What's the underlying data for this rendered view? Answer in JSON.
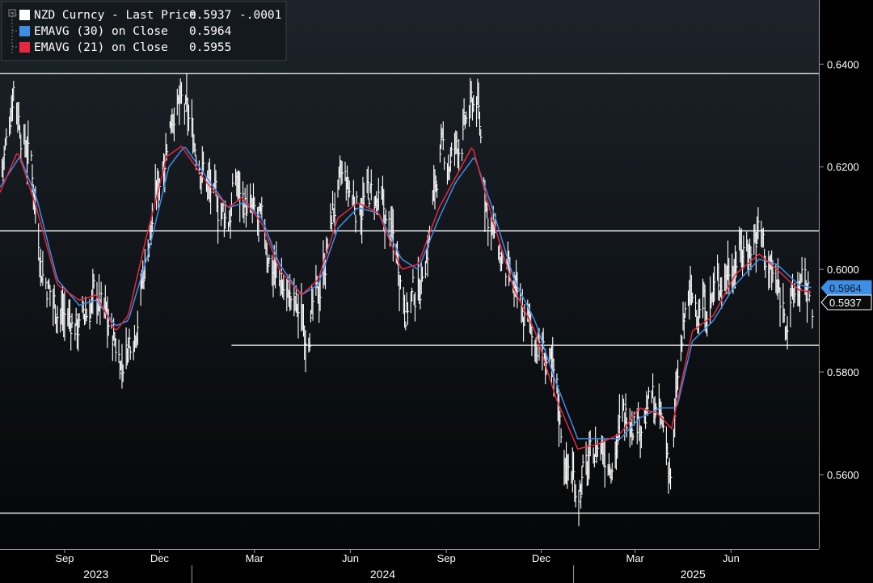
{
  "chart_data": {
    "type": "line",
    "subtype": "high-low bars with moving averages",
    "ylim": [
      0.5455,
      0.6525
    ],
    "y_ticks": [
      "0.6400",
      "0.6200",
      "0.6000",
      "0.5800",
      "0.5600"
    ],
    "y_tick_values": [
      0.64,
      0.62,
      0.6,
      0.58,
      0.56
    ],
    "x_start": "2023-07-01",
    "x_end": "2025-08-18",
    "x_ticks": [
      {
        "label": "Sep",
        "date": "2023-09-01"
      },
      {
        "label": "Dec",
        "date": "2023-12-01"
      },
      {
        "label": "Mar",
        "date": "2024-03-01"
      },
      {
        "label": "Jun",
        "date": "2024-06-01"
      },
      {
        "label": "Sep",
        "date": "2024-09-01"
      },
      {
        "label": "Dec",
        "date": "2024-12-01"
      },
      {
        "label": "Mar",
        "date": "2025-03-01"
      },
      {
        "label": "Jun",
        "date": "2025-06-01"
      }
    ],
    "years": [
      {
        "label": "2023",
        "from": "2023-07-01",
        "to": "2024-01-01"
      },
      {
        "label": "2024",
        "from": "2024-01-01",
        "to": "2025-01-01"
      },
      {
        "label": "2025",
        "from": "2025-01-01",
        "to": "2025-08-18"
      }
    ],
    "h_lines": [
      {
        "y": 0.6382,
        "from": "2023-07-01"
      },
      {
        "y": 0.6075,
        "from": "2023-07-01"
      },
      {
        "y": 0.5852,
        "from": "2024-02-08"
      },
      {
        "y": 0.5525,
        "from": "2023-07-01"
      }
    ],
    "legend": [
      {
        "color_key": "price",
        "name": "NZD Curncy - Last Price",
        "value": "0.5937",
        "change": "-.0001"
      },
      {
        "color_key": "ema30",
        "name": "EMAVG (30)  on Close",
        "value": "0.5964",
        "change": ""
      },
      {
        "color_key": "ema21",
        "name": "EMAVG (21)  on Close",
        "value": "0.5955",
        "change": ""
      }
    ],
    "last_value_tags": [
      {
        "label": "0.5964",
        "value": 0.5964,
        "color_key": "ema30"
      },
      {
        "label": "0.5937",
        "value": 0.5937,
        "color_key": "price"
      }
    ],
    "price_anchors": [
      [
        "2023-07-01",
        0.618
      ],
      [
        "2023-07-08",
        0.625
      ],
      [
        "2023-07-14",
        0.637
      ],
      [
        "2023-07-21",
        0.628
      ],
      [
        "2023-07-31",
        0.621
      ],
      [
        "2023-08-10",
        0.601
      ],
      [
        "2023-08-20",
        0.594
      ],
      [
        "2023-09-01",
        0.591
      ],
      [
        "2023-09-15",
        0.589
      ],
      [
        "2023-10-01",
        0.595
      ],
      [
        "2023-10-15",
        0.588
      ],
      [
        "2023-10-26",
        0.582
      ],
      [
        "2023-11-08",
        0.59
      ],
      [
        "2023-11-20",
        0.605
      ],
      [
        "2023-11-28",
        0.614
      ],
      [
        "2023-12-08",
        0.626
      ],
      [
        "2023-12-15",
        0.633
      ],
      [
        "2023-12-28",
        0.629
      ],
      [
        "2024-01-10",
        0.621
      ],
      [
        "2024-01-22",
        0.613
      ],
      [
        "2024-02-05",
        0.61
      ],
      [
        "2024-02-12",
        0.617
      ],
      [
        "2024-02-25",
        0.611
      ],
      [
        "2024-03-08",
        0.607
      ],
      [
        "2024-03-20",
        0.6
      ],
      [
        "2024-04-05",
        0.594
      ],
      [
        "2024-04-18",
        0.589
      ],
      [
        "2024-05-01",
        0.594
      ],
      [
        "2024-05-15",
        0.611
      ],
      [
        "2024-05-25",
        0.617
      ],
      [
        "2024-06-05",
        0.613
      ],
      [
        "2024-06-20",
        0.614
      ],
      [
        "2024-07-01",
        0.611
      ],
      [
        "2024-07-15",
        0.604
      ],
      [
        "2024-07-25",
        0.593
      ],
      [
        "2024-08-05",
        0.596
      ],
      [
        "2024-08-15",
        0.606
      ],
      [
        "2024-08-25",
        0.622
      ],
      [
        "2024-09-05",
        0.621
      ],
      [
        "2024-09-18",
        0.627
      ],
      [
        "2024-09-30",
        0.634
      ],
      [
        "2024-10-10",
        0.612
      ],
      [
        "2024-10-25",
        0.6
      ],
      [
        "2024-11-10",
        0.592
      ],
      [
        "2024-11-25",
        0.587
      ],
      [
        "2024-12-05",
        0.583
      ],
      [
        "2024-12-15",
        0.576
      ],
      [
        "2024-12-25",
        0.562
      ],
      [
        "2025-01-05",
        0.558
      ],
      [
        "2025-01-15",
        0.561
      ],
      [
        "2025-01-25",
        0.566
      ],
      [
        "2025-02-05",
        0.564
      ],
      [
        "2025-02-15",
        0.569
      ],
      [
        "2025-02-25",
        0.573
      ],
      [
        "2025-03-08",
        0.571
      ],
      [
        "2025-03-18",
        0.574
      ],
      [
        "2025-03-28",
        0.568
      ],
      [
        "2025-04-05",
        0.56
      ],
      [
        "2025-04-10",
        0.576
      ],
      [
        "2025-04-20",
        0.594
      ],
      [
        "2025-05-01",
        0.593
      ],
      [
        "2025-05-12",
        0.594
      ],
      [
        "2025-05-22",
        0.598
      ],
      [
        "2025-06-05",
        0.603
      ],
      [
        "2025-06-20",
        0.605
      ],
      [
        "2025-06-28",
        0.608
      ],
      [
        "2025-07-05",
        0.602
      ],
      [
        "2025-07-15",
        0.596
      ],
      [
        "2025-07-25",
        0.591
      ],
      [
        "2025-08-05",
        0.597
      ],
      [
        "2025-08-18",
        0.5937
      ]
    ],
    "ema30_anchors": [
      [
        "2023-07-01",
        0.616
      ],
      [
        "2023-07-20",
        0.622
      ],
      [
        "2023-08-05",
        0.614
      ],
      [
        "2023-08-25",
        0.598
      ],
      [
        "2023-09-15",
        0.593
      ],
      [
        "2023-10-01",
        0.594
      ],
      [
        "2023-10-20",
        0.589
      ],
      [
        "2023-11-01",
        0.59
      ],
      [
        "2023-11-20",
        0.603
      ],
      [
        "2023-12-10",
        0.62
      ],
      [
        "2023-12-25",
        0.624
      ],
      [
        "2024-01-15",
        0.618
      ],
      [
        "2024-02-05",
        0.612
      ],
      [
        "2024-02-20",
        0.613
      ],
      [
        "2024-03-08",
        0.61
      ],
      [
        "2024-03-25",
        0.601
      ],
      [
        "2024-04-15",
        0.595
      ],
      [
        "2024-05-01",
        0.597
      ],
      [
        "2024-05-20",
        0.608
      ],
      [
        "2024-06-08",
        0.612
      ],
      [
        "2024-06-28",
        0.611
      ],
      [
        "2024-07-20",
        0.602
      ],
      [
        "2024-08-05",
        0.6
      ],
      [
        "2024-08-25",
        0.61
      ],
      [
        "2024-09-10",
        0.617
      ],
      [
        "2024-09-28",
        0.622
      ],
      [
        "2024-10-15",
        0.612
      ],
      [
        "2024-11-05",
        0.598
      ],
      [
        "2024-11-25",
        0.59
      ],
      [
        "2024-12-15",
        0.578
      ],
      [
        "2025-01-05",
        0.567
      ],
      [
        "2025-01-25",
        0.567
      ],
      [
        "2025-02-15",
        0.567
      ],
      [
        "2025-03-05",
        0.571
      ],
      [
        "2025-03-25",
        0.573
      ],
      [
        "2025-04-10",
        0.573
      ],
      [
        "2025-04-25",
        0.586
      ],
      [
        "2025-05-15",
        0.59
      ],
      [
        "2025-06-05",
        0.597
      ],
      [
        "2025-06-28",
        0.602
      ],
      [
        "2025-07-15",
        0.601
      ],
      [
        "2025-08-05",
        0.597
      ],
      [
        "2025-08-18",
        0.5964
      ]
    ],
    "ema21_anchors": [
      [
        "2023-07-01",
        0.615
      ],
      [
        "2023-07-18",
        0.623
      ],
      [
        "2023-08-05",
        0.612
      ],
      [
        "2023-08-25",
        0.597
      ],
      [
        "2023-09-15",
        0.594
      ],
      [
        "2023-10-01",
        0.595
      ],
      [
        "2023-10-20",
        0.588
      ],
      [
        "2023-11-01",
        0.591
      ],
      [
        "2023-11-18",
        0.606
      ],
      [
        "2023-12-08",
        0.622
      ],
      [
        "2023-12-22",
        0.624
      ],
      [
        "2024-01-15",
        0.617
      ],
      [
        "2024-02-05",
        0.612
      ],
      [
        "2024-02-18",
        0.614
      ],
      [
        "2024-03-08",
        0.609
      ],
      [
        "2024-03-25",
        0.6
      ],
      [
        "2024-04-15",
        0.595
      ],
      [
        "2024-05-01",
        0.598
      ],
      [
        "2024-05-20",
        0.61
      ],
      [
        "2024-06-08",
        0.613
      ],
      [
        "2024-06-28",
        0.611
      ],
      [
        "2024-07-20",
        0.6
      ],
      [
        "2024-08-05",
        0.601
      ],
      [
        "2024-08-25",
        0.612
      ],
      [
        "2024-09-10",
        0.618
      ],
      [
        "2024-09-26",
        0.624
      ],
      [
        "2024-10-15",
        0.61
      ],
      [
        "2024-11-05",
        0.596
      ],
      [
        "2024-11-25",
        0.588
      ],
      [
        "2024-12-15",
        0.575
      ],
      [
        "2025-01-05",
        0.565
      ],
      [
        "2025-01-25",
        0.566
      ],
      [
        "2025-02-15",
        0.568
      ],
      [
        "2025-03-05",
        0.573
      ],
      [
        "2025-03-22",
        0.572
      ],
      [
        "2025-04-05",
        0.569
      ],
      [
        "2025-04-25",
        0.588
      ],
      [
        "2025-05-15",
        0.591
      ],
      [
        "2025-06-05",
        0.599
      ],
      [
        "2025-06-28",
        0.603
      ],
      [
        "2025-07-15",
        0.6
      ],
      [
        "2025-08-05",
        0.596
      ],
      [
        "2025-08-18",
        0.5955
      ]
    ],
    "colors": {
      "price": "#ffffff",
      "ema30": "#3d8fe6",
      "ema21": "#e8283f",
      "hline": "#ffffff",
      "axis": "#9a9a9a",
      "background_top": "#1c232a",
      "background_bottom": "#050607"
    }
  }
}
